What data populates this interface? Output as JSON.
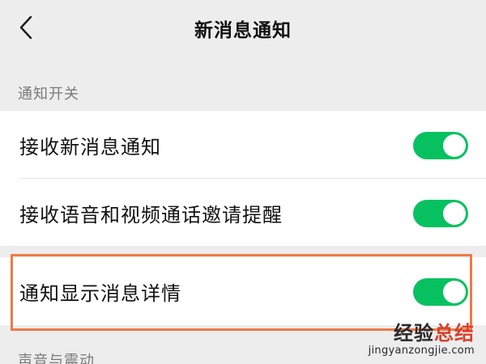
{
  "nav": {
    "title": "新消息通知",
    "back_icon": "chevron-left-icon"
  },
  "sections": [
    {
      "header": "通知开关",
      "rows": [
        {
          "label": "接收新消息通知",
          "enabled": true
        },
        {
          "label": "接收语音和视频通话邀请提醒",
          "enabled": true
        }
      ]
    },
    {
      "header": "",
      "rows": [
        {
          "label": "通知显示消息详情",
          "enabled": true
        }
      ]
    },
    {
      "header": "声音与震动",
      "rows": []
    }
  ],
  "highlight": {
    "color": "#ee7a45",
    "target": "通知显示消息详情"
  },
  "colors": {
    "toggle_on": "#07c160",
    "background": "#ededed",
    "row_background": "#ffffff"
  },
  "watermark": {
    "part_a": "经验",
    "part_b": "总结",
    "url": "jingyanzongjie.com"
  }
}
